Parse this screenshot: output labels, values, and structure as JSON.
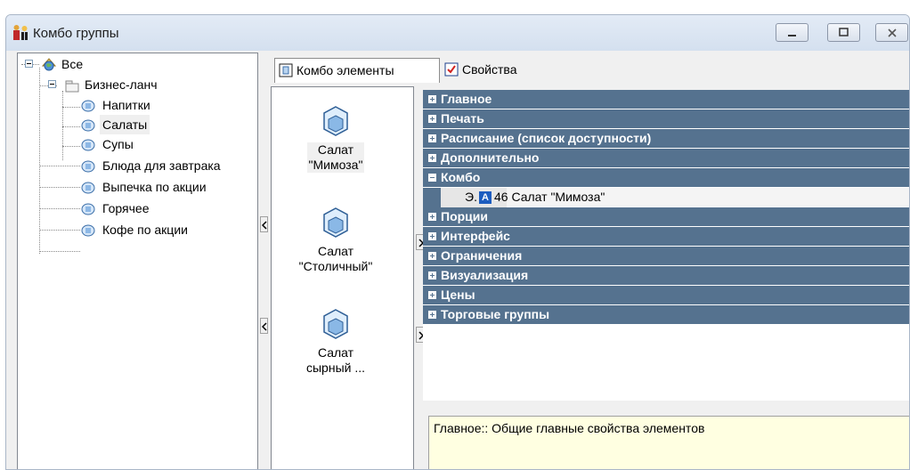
{
  "window": {
    "title": "Комбо группы"
  },
  "tree": {
    "root": "Все",
    "nodes": [
      {
        "label": "Бизнес-ланч"
      },
      {
        "label": "Напитки"
      },
      {
        "label": "Салаты"
      },
      {
        "label": "Супы"
      },
      {
        "label": "Блюда для завтрака"
      },
      {
        "label": "Выпечка по акции"
      },
      {
        "label": "Горячее"
      },
      {
        "label": "Кофе по акции"
      }
    ]
  },
  "tabs": [
    {
      "label": "Комбо элементы",
      "active": true
    },
    {
      "label": "Свойства",
      "active": false
    }
  ],
  "elements": [
    {
      "caption_line1": "Салат",
      "caption_line2": "\"Мимоза\""
    },
    {
      "caption_line1": "Салат",
      "caption_line2": "\"Столичный\""
    },
    {
      "caption_line1": "Салат",
      "caption_line2": "сырный ..."
    }
  ],
  "properties": {
    "categories": [
      {
        "label": "Главное",
        "expanded": false
      },
      {
        "label": "Печать",
        "expanded": false
      },
      {
        "label": "Расписание (список доступности)",
        "expanded": false
      },
      {
        "label": "Дополнительно",
        "expanded": false
      },
      {
        "label": "Комбо",
        "expanded": true
      },
      {
        "label": "Порции",
        "expanded": false
      },
      {
        "label": "Интерфейс",
        "expanded": false
      },
      {
        "label": "Ограничения",
        "expanded": false
      },
      {
        "label": "Визуализация",
        "expanded": false
      },
      {
        "label": "Цены",
        "expanded": false
      },
      {
        "label": "Торговые группы",
        "expanded": false
      }
    ],
    "combo_row": {
      "key": "Э.",
      "badge": "A",
      "value": "46 Салат \"Мимоза\""
    }
  },
  "description": "Главное:: Общие главные свойства элементов",
  "colors": {
    "category_bg": "#55728f",
    "description_bg": "#ffffe1",
    "badge": "#1d5dbf"
  },
  "icons": {
    "app": "restaurant-icon",
    "root": "world-folder-icon",
    "group": "folder-icon",
    "node": "combo-node-icon",
    "element": "cube-icon",
    "tab_elements": "combo-tab-icon",
    "tab_properties": "properties-tab-icon"
  }
}
